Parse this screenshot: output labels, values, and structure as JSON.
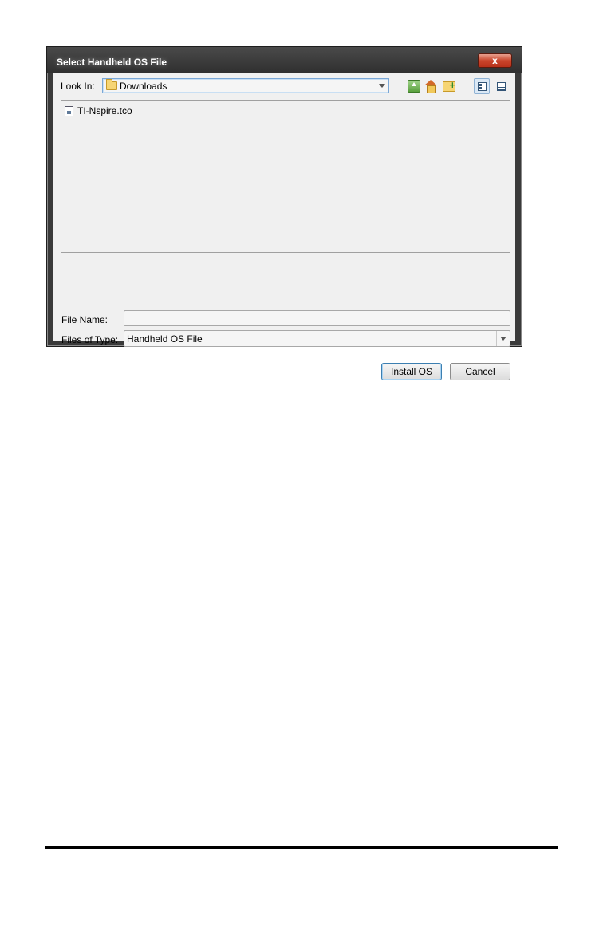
{
  "dialog": {
    "title": "Select Handheld OS File",
    "close_label": "x"
  },
  "look_in": {
    "label": "Look In:",
    "value": "Downloads"
  },
  "toolbar": {
    "icons": [
      "up-one-level-icon",
      "home-icon",
      "new-folder-icon",
      "list-view-icon",
      "details-view-icon"
    ]
  },
  "files": [
    {
      "name": "TI-Nspire.tco"
    }
  ],
  "file_name": {
    "label": "File Name:",
    "value": ""
  },
  "files_of_type": {
    "label": "Files of Type:",
    "value": "Handheld OS File"
  },
  "buttons": {
    "install": "Install OS",
    "cancel": "Cancel"
  },
  "colors": {
    "title_bar": "#3a3a3a",
    "close_button": "#c9452c",
    "client_bg": "#f0f0f0",
    "focus_border": "#7aa7d6"
  }
}
